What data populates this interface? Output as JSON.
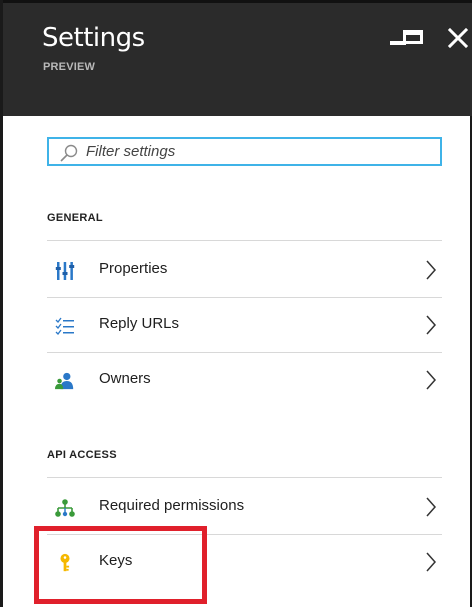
{
  "window": {
    "title": "Settings",
    "subtitle": "PREVIEW",
    "controls": {
      "minimize": "minimize",
      "maximize": "maximize",
      "close": "close"
    }
  },
  "filter": {
    "placeholder": "Filter settings"
  },
  "sections": {
    "general": {
      "label": "GENERAL",
      "items": [
        {
          "label": "Properties",
          "icon": "properties-icon"
        },
        {
          "label": "Reply URLs",
          "icon": "reply-urls-icon"
        },
        {
          "label": "Owners",
          "icon": "owners-icon"
        }
      ]
    },
    "api_access": {
      "label": "API ACCESS",
      "items": [
        {
          "label": "Required permissions",
          "icon": "permissions-icon"
        },
        {
          "label": "Keys",
          "icon": "key-icon"
        }
      ]
    }
  },
  "colors": {
    "header_bg": "#2b2b2b",
    "accent": "#3fb3e8",
    "icon_blue": "#2a78c8",
    "icon_green": "#3a9a3a",
    "key_yellow": "#f5b800",
    "highlight_red": "#e0202b"
  }
}
